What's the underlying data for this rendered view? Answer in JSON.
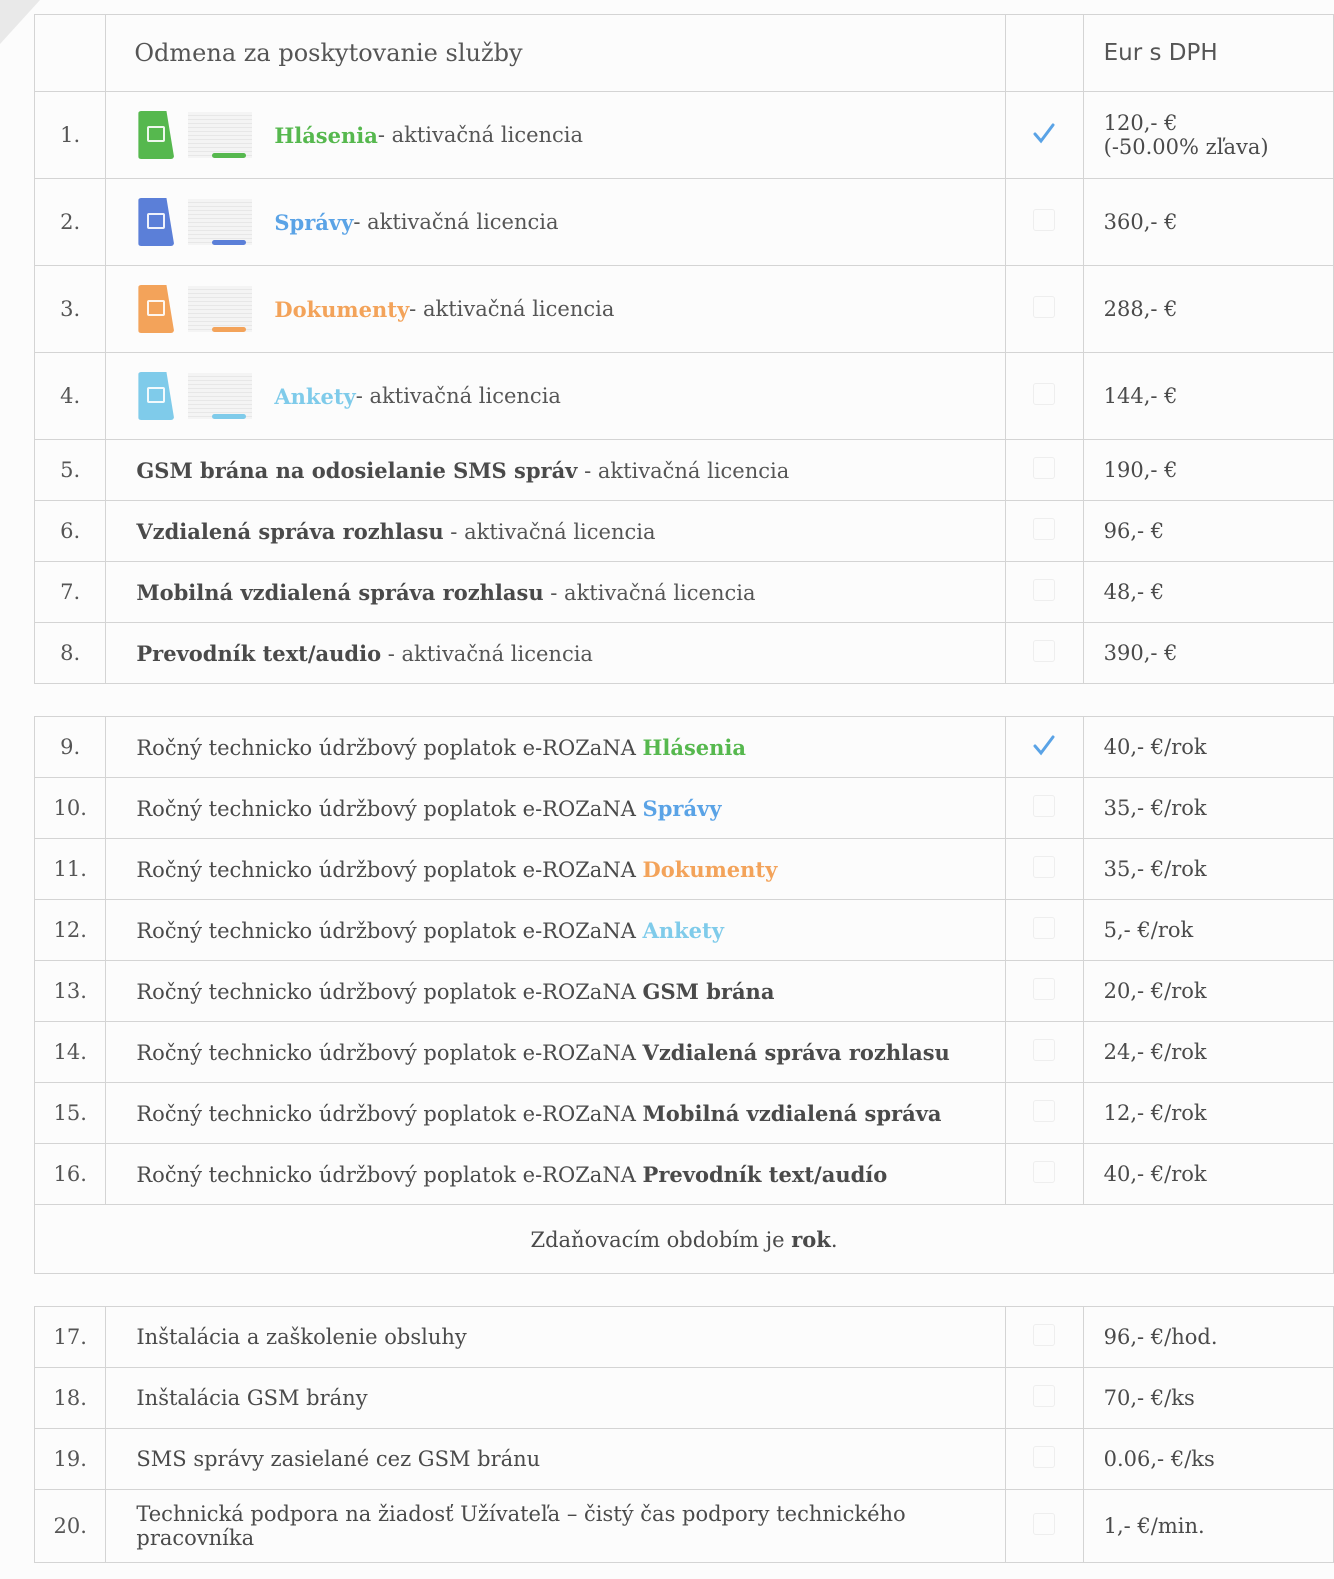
{
  "header": {
    "col_description": "Odmena za poskytovanie služby",
    "col_price": "Eur s DPH"
  },
  "colors": {
    "hlasenia": "#56b84e",
    "spravy": "#5aa3e6",
    "dokumenty": "#f3a35a",
    "ankety": "#7fcbea"
  },
  "apps": [
    {
      "num": "1.",
      "name": "Hlásenia",
      "suffix": " - aktivačná licencia",
      "price": "120,- €",
      "price_note": "(-50.00% zľava)",
      "checked": true,
      "icon": "speaker-icon"
    },
    {
      "num": "2.",
      "name": "Správy",
      "suffix": " - aktivačná licencia",
      "price": "360,- €",
      "price_note": "",
      "checked": false,
      "icon": "envelope-icon"
    },
    {
      "num": "3.",
      "name": "Dokumenty",
      "suffix": " - aktivačná licencia",
      "price": "288,- €",
      "price_note": "",
      "checked": false,
      "icon": "document-icon"
    },
    {
      "num": "4.",
      "name": "Ankety",
      "suffix": " - aktivačná licencia",
      "price": "144,- €",
      "price_note": "",
      "checked": false,
      "icon": "poll-icon"
    }
  ],
  "licenses": [
    {
      "num": "5.",
      "name": "GSM brána na odosielanie SMS správ",
      "suffix": " - aktivačná licencia",
      "price": "190,- €"
    },
    {
      "num": "6.",
      "name": "Vzdialená správa rozhlasu",
      "suffix": " - aktivačná licencia",
      "price": "96,- €"
    },
    {
      "num": "7.",
      "name": "Mobilná vzdialená správa rozhlasu",
      "suffix": " - aktivačná licencia",
      "price": "48,- €"
    },
    {
      "num": "8.",
      "name": "Prevodník text/audio",
      "suffix": " - aktivačná licencia",
      "price": "390,- €"
    }
  ],
  "annual_prefix": "Ročný technicko údržbový poplatok e-ROZaNA ",
  "annual": [
    {
      "num": "9.",
      "name": "Hlásenia",
      "price": "40,- €/rok",
      "checked": true
    },
    {
      "num": "10.",
      "name": "Správy",
      "price": "35,- €/rok",
      "checked": false
    },
    {
      "num": "11.",
      "name": "Dokumenty",
      "price": "35,- €/rok",
      "checked": false
    },
    {
      "num": "12.",
      "name": "Ankety",
      "price": "5,- €/rok",
      "checked": false
    },
    {
      "num": "13.",
      "name": "GSM brána",
      "price": "20,- €/rok",
      "checked": false
    },
    {
      "num": "14.",
      "name": "Vzdialená správa rozhlasu",
      "price": "24,- €/rok",
      "checked": false
    },
    {
      "num": "15.",
      "name": "Mobilná vzdialená správa",
      "price": "12,- €/rok",
      "checked": false
    },
    {
      "num": "16.",
      "name": "Prevodník text/audío",
      "price": "40,- €/rok",
      "checked": false
    }
  ],
  "tax_note": {
    "text": "Zdaňovacím obdobím je ",
    "bold": "rok",
    "end": "."
  },
  "services": [
    {
      "num": "17.",
      "text": "Inštalácia a zaškolenie obsluhy",
      "price": "96,- €/hod."
    },
    {
      "num": "18.",
      "text": "Inštalácia GSM brány",
      "price": "70,- €/ks"
    },
    {
      "num": "19.",
      "text": "SMS správy zasielané cez GSM bránu",
      "price": "0.06,- €/ks"
    },
    {
      "num": "20.",
      "text": "Technická podpora na žiadosť Užívateľa – čistý čas podpory technického pracovníka",
      "price": "1,- €/min."
    }
  ]
}
